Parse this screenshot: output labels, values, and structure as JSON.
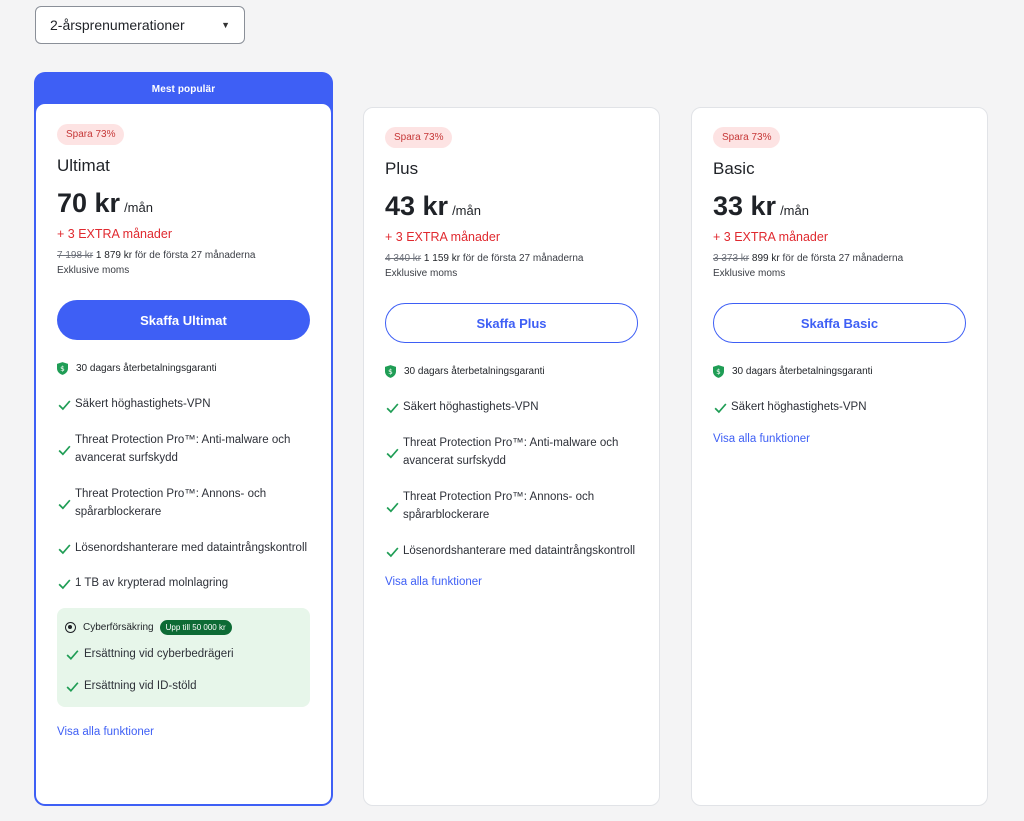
{
  "filter": {
    "selected": "2-årsprenumerationer"
  },
  "colors": {
    "accent": "#3e5ff5",
    "extra": "#e0292f",
    "guarantee": "#1f9d55",
    "insurance_bg": "#e7f6ea"
  },
  "plans": [
    {
      "banner": "Mest populär",
      "badge": "Spara 73%",
      "name": "Ultimat",
      "price": "70 kr",
      "per": "/mån",
      "extra": "+ 3 EXTRA månader",
      "old_price": "7 198 kr",
      "new_price": "1 879 kr",
      "period": "för de första 27 månaderna",
      "tax": "Exklusive moms",
      "cta": "Skaffa Ultimat",
      "guarantee": "30 dagars återbetalningsgaranti",
      "features": [
        "Säkert höghastighets-VPN",
        "Threat Protection Pro™: Anti-malware och avancerat surfskydd",
        "Threat Protection Pro™: Annons- och spårarblockerare",
        "Lösenordshanterare med dataintrångskontroll",
        "1 TB av krypterad molnlagring"
      ],
      "insurance": {
        "title": "Cyberförsäkring",
        "pill": "Upp till 50 000 kr",
        "items": [
          "Ersättning vid cyberbedrägeri",
          "Ersättning vid ID-stöld"
        ]
      },
      "link": "Visa alla funktioner"
    },
    {
      "badge": "Spara 73%",
      "name": "Plus",
      "price": "43 kr",
      "per": "/mån",
      "extra": "+ 3 EXTRA månader",
      "old_price": "4 340 kr",
      "new_price": "1 159 kr",
      "period": "för de första 27 månaderna",
      "tax": "Exklusive moms",
      "cta": "Skaffa Plus",
      "guarantee": "30 dagars återbetalningsgaranti",
      "features": [
        "Säkert höghastighets-VPN",
        "Threat Protection Pro™: Anti-malware och avancerat surfskydd",
        "Threat Protection Pro™: Annons- och spårarblockerare",
        "Lösenordshanterare med dataintrångskontroll"
      ],
      "link": "Visa alla funktioner"
    },
    {
      "badge": "Spara 73%",
      "name": "Basic",
      "price": "33 kr",
      "per": "/mån",
      "extra": "+ 3 EXTRA månader",
      "old_price": "3 373 kr",
      "new_price": "899 kr",
      "period": "för de första 27 månaderna",
      "tax": "Exklusive moms",
      "cta": "Skaffa Basic",
      "guarantee": "30 dagars återbetalningsgaranti",
      "features": [
        "Säkert höghastighets-VPN"
      ],
      "link": "Visa alla funktioner"
    }
  ]
}
